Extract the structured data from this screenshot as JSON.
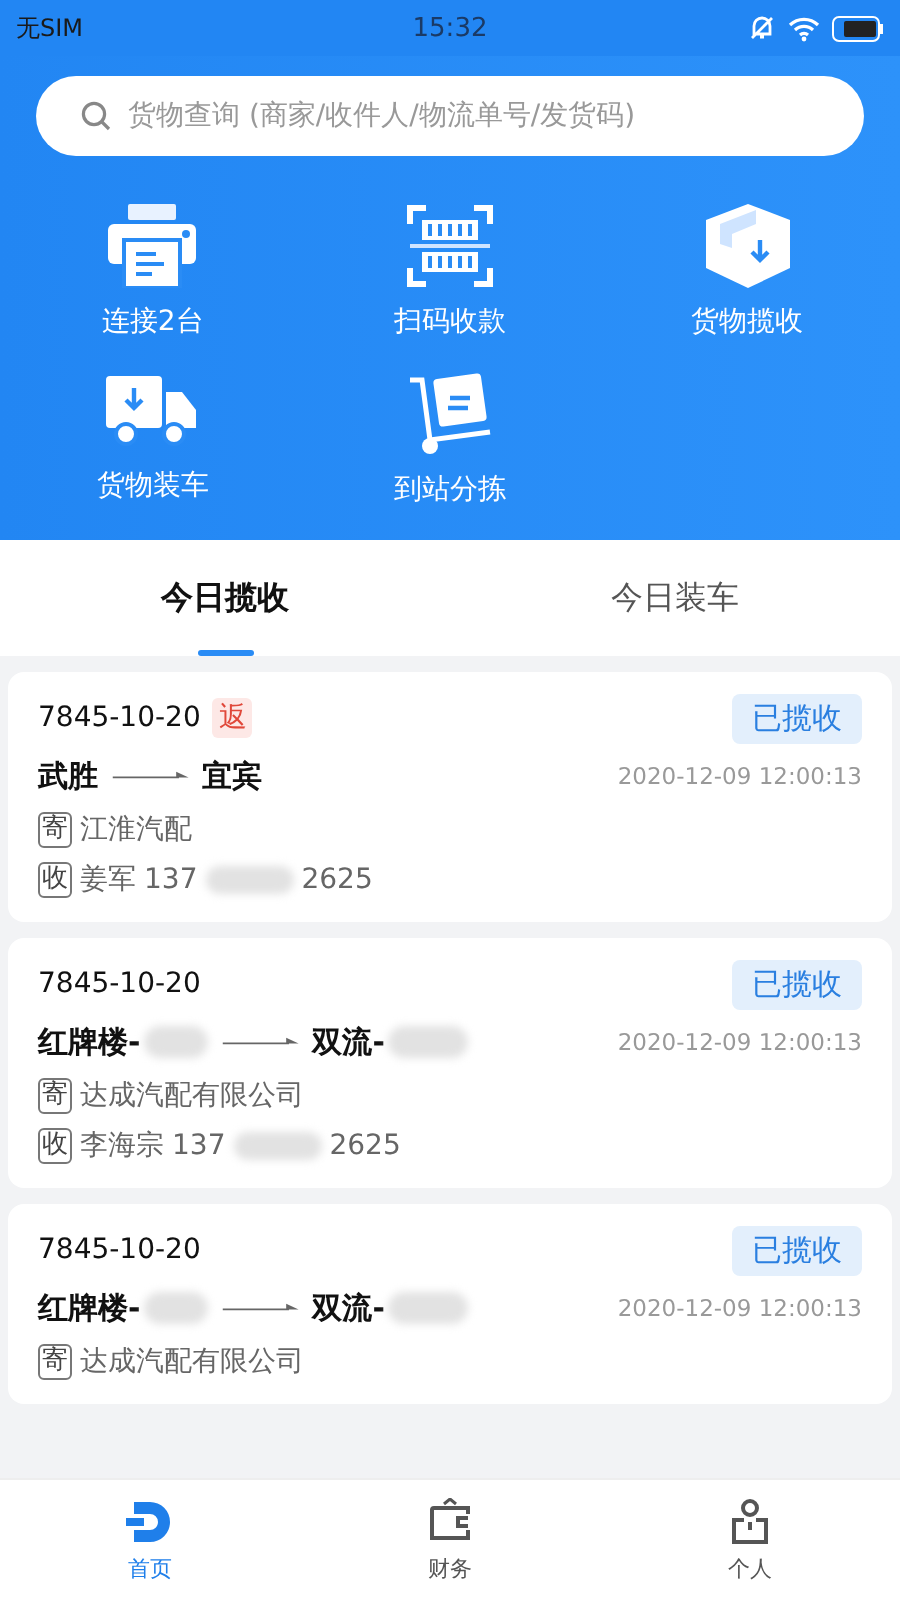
{
  "status_bar": {
    "carrier": "无SIM",
    "time": "15:32"
  },
  "search": {
    "placeholder": "货物查询 (商家/收件人/物流单号/发货码)"
  },
  "actions": [
    {
      "kind": "printer",
      "label": "连接2台"
    },
    {
      "kind": "scan",
      "label": "扫码收款"
    },
    {
      "kind": "box",
      "label": "货物揽收"
    },
    {
      "kind": "truck",
      "label": "货物装车"
    },
    {
      "kind": "cart",
      "label": "到站分拣"
    }
  ],
  "tabs": [
    {
      "label": "今日揽收",
      "selected": true
    },
    {
      "label": "今日装车",
      "selected": false
    }
  ],
  "orders": [
    {
      "number": "7845-10-20",
      "tag": "返",
      "status": "已揽收",
      "from": "武胜",
      "from_redacted": false,
      "to": "宜宾",
      "to_redacted": false,
      "time": "2020-12-09 12:00:13",
      "sender_mark": "寄",
      "sender": "江淮汽配",
      "receiver_mark": "收",
      "receiver": "姜军",
      "phone_start": "137",
      "phone_end": "2625"
    },
    {
      "number": "7845-10-20",
      "status": "已揽收",
      "from": "红牌楼-",
      "from_redacted": true,
      "to": "双流-",
      "to_redacted": true,
      "time": "2020-12-09 12:00:13",
      "sender_mark": "寄",
      "sender": "达成汽配有限公司",
      "receiver_mark": "收",
      "receiver": "李海宗",
      "phone_start": "137",
      "phone_end": "2625"
    },
    {
      "number": "7845-10-20",
      "status": "已揽收",
      "from": "红牌楼-",
      "from_redacted": true,
      "to": "双流-",
      "to_redacted": true,
      "time": "2020-12-09 12:00:13",
      "sender_mark": "寄",
      "sender": "达成汽配有限公司"
    }
  ],
  "nav": [
    {
      "kind": "home",
      "label": "首页",
      "selected": true
    },
    {
      "kind": "wallet",
      "label": "财务",
      "selected": false
    },
    {
      "kind": "person",
      "label": "个人",
      "selected": false
    }
  ]
}
